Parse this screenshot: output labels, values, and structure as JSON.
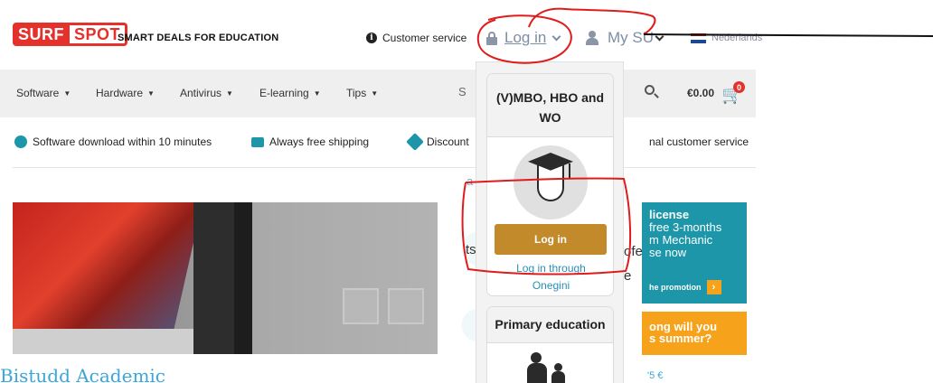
{
  "header": {
    "logo_left": "SURF",
    "logo_right": "SPOT",
    "tagline": "SMART DEALS FOR EDUCATION",
    "customer_service": "Customer service",
    "login_label": "Log in",
    "my_su_label": "My SU",
    "language": "Nederlands"
  },
  "nav": {
    "items": [
      "Software",
      "Hardware",
      "Antivirus",
      "E-learning",
      "Tips"
    ],
    "search_partial": "S",
    "cart_amount": "€0.00",
    "cart_count": "0"
  },
  "usps": {
    "download": "Software download within 10 minutes",
    "shipping": "Always free shipping",
    "discount": "Discount",
    "customer_service": "nal customer service"
  },
  "dropdown": {
    "card1_title": "(V)MBO, HBO and WO",
    "login_button": "Log in",
    "login_through": "Log in through",
    "onegini": "Onegini",
    "card2_title": "Primary education"
  },
  "main": {
    "hero_link": "Bistudd Academic",
    "behind_a": "a",
    "behind_ts": "ts",
    "behind_ofes": "ofes",
    "behind_e": "e",
    "promo1_title": "license",
    "promo1_line1": "free 3-months",
    "promo1_line2": "m Mechanic",
    "promo1_line3": "se now",
    "promo1_cta": "he promotion",
    "promo2_line1": "ong will you",
    "promo2_line2": "s summer?",
    "promo3": "'5 €"
  },
  "colors": {
    "brand_red": "#e4312b",
    "login_gold": "#c28a2b",
    "teal": "#1c96a8",
    "orange": "#f6a21a",
    "annotation_red": "#e01b1b"
  }
}
